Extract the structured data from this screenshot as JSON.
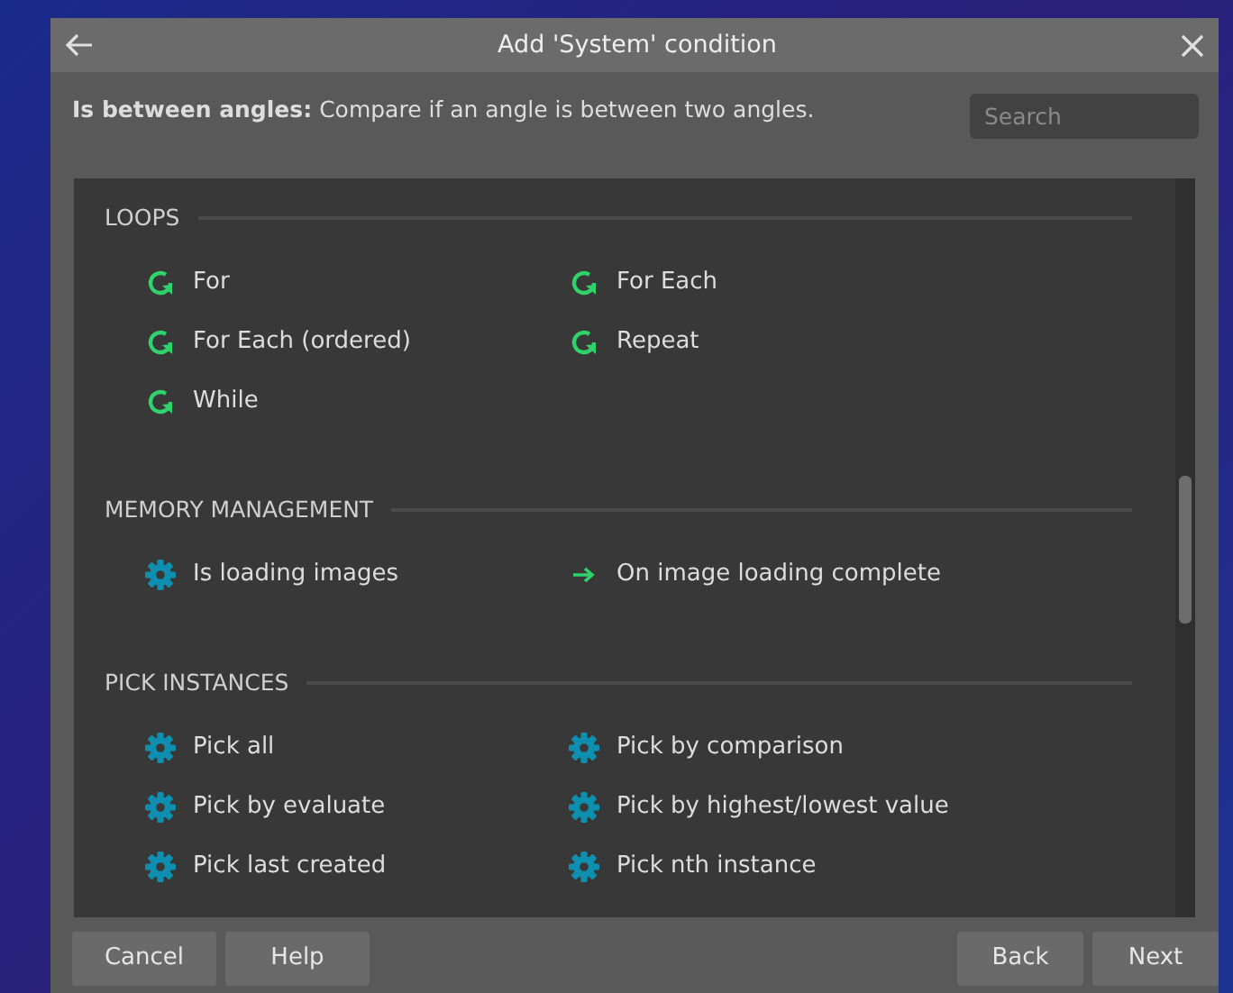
{
  "window": {
    "title": "Add 'System' condition"
  },
  "description": {
    "name": "Is between angles:",
    "text": "Compare if an angle is between two angles."
  },
  "search": {
    "placeholder": "Search"
  },
  "sections": [
    {
      "heading": "LOOPS",
      "items": [
        {
          "label": "For",
          "kind": "loop"
        },
        {
          "label": "For Each",
          "kind": "loop"
        },
        {
          "label": "For Each (ordered)",
          "kind": "loop"
        },
        {
          "label": "Repeat",
          "kind": "loop"
        },
        {
          "label": "While",
          "kind": "loop"
        }
      ]
    },
    {
      "heading": "MEMORY MANAGEMENT",
      "items": [
        {
          "label": "Is loading images",
          "kind": "condition"
        },
        {
          "label": "On image loading complete",
          "kind": "trigger"
        }
      ]
    },
    {
      "heading": "PICK INSTANCES",
      "items": [
        {
          "label": "Pick all",
          "kind": "condition"
        },
        {
          "label": "Pick by comparison",
          "kind": "condition"
        },
        {
          "label": "Pick by evaluate",
          "kind": "condition"
        },
        {
          "label": "Pick by highest/lowest value",
          "kind": "condition"
        },
        {
          "label": "Pick last created",
          "kind": "condition"
        },
        {
          "label": "Pick nth instance",
          "kind": "condition"
        }
      ]
    }
  ],
  "buttons_left": [
    "Cancel",
    "Help"
  ],
  "buttons_right": [
    "Back",
    "Next"
  ]
}
